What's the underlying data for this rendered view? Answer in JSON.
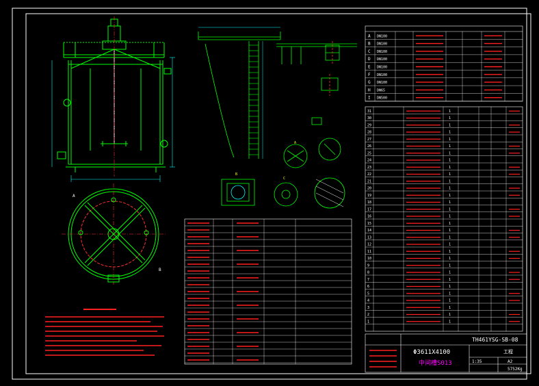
{
  "colors": {
    "background": "#000000",
    "frame": "#ffffff",
    "equipment": "#00ff00",
    "dimension": "#00ffff",
    "centerline": "#ff3030",
    "annotation": "#ffff00",
    "table_text": "#ff2020",
    "accent": "#ff00ff"
  },
  "title_block": {
    "drawing_number": "TH461YSG-SB-08",
    "equipment_spec": "Φ3611X4100",
    "equipment_name": "中间槽S013",
    "sheet_size": "A2",
    "scale": "1:35",
    "weight": "5752Kg",
    "unit": "工程"
  },
  "nozzle_table": {
    "rows": [
      {
        "mark": "A",
        "size": "DN100"
      },
      {
        "mark": "B",
        "size": "DN100"
      },
      {
        "mark": "C",
        "size": "DN100"
      },
      {
        "mark": "D",
        "size": "DN100"
      },
      {
        "mark": "E",
        "size": "DN100"
      },
      {
        "mark": "F",
        "size": "DN100"
      },
      {
        "mark": "G",
        "size": "DN100"
      },
      {
        "mark": "H",
        "size": "DN65"
      },
      {
        "mark": "I",
        "size": "DN500"
      }
    ]
  },
  "parts_list": {
    "rows": [
      {
        "no": "31",
        "qty": "1"
      },
      {
        "no": "30",
        "qty": "1"
      },
      {
        "no": "29",
        "qty": "1"
      },
      {
        "no": "28",
        "qty": "1"
      },
      {
        "no": "27",
        "qty": "1"
      },
      {
        "no": "26",
        "qty": "1"
      },
      {
        "no": "25",
        "qty": "1"
      },
      {
        "no": "24",
        "qty": "1"
      },
      {
        "no": "23",
        "qty": "1"
      },
      {
        "no": "22",
        "qty": "1"
      },
      {
        "no": "21",
        "qty": "1"
      },
      {
        "no": "20",
        "qty": "1"
      },
      {
        "no": "19",
        "qty": "1"
      },
      {
        "no": "18",
        "qty": "1"
      },
      {
        "no": "17",
        "qty": "1"
      },
      {
        "no": "16",
        "qty": "1"
      },
      {
        "no": "15",
        "qty": "1"
      },
      {
        "no": "14",
        "qty": "1"
      },
      {
        "no": "13",
        "qty": "1"
      },
      {
        "no": "12",
        "qty": "1"
      },
      {
        "no": "11",
        "qty": "1"
      },
      {
        "no": "10",
        "qty": "1"
      },
      {
        "no": "9",
        "qty": "1"
      },
      {
        "no": "8",
        "qty": "1"
      },
      {
        "no": "7",
        "qty": "1"
      },
      {
        "no": "6",
        "qty": "1"
      },
      {
        "no": "5",
        "qty": "1"
      },
      {
        "no": "4",
        "qty": "1"
      },
      {
        "no": "3",
        "qty": "1"
      },
      {
        "no": "2",
        "qty": "1"
      },
      {
        "no": "1",
        "qty": "1"
      }
    ]
  },
  "plan_view": {
    "label_a": "A",
    "label_b": "B"
  },
  "section_labels": {
    "view_a": "A",
    "view_b": "B",
    "view_c": "C"
  }
}
